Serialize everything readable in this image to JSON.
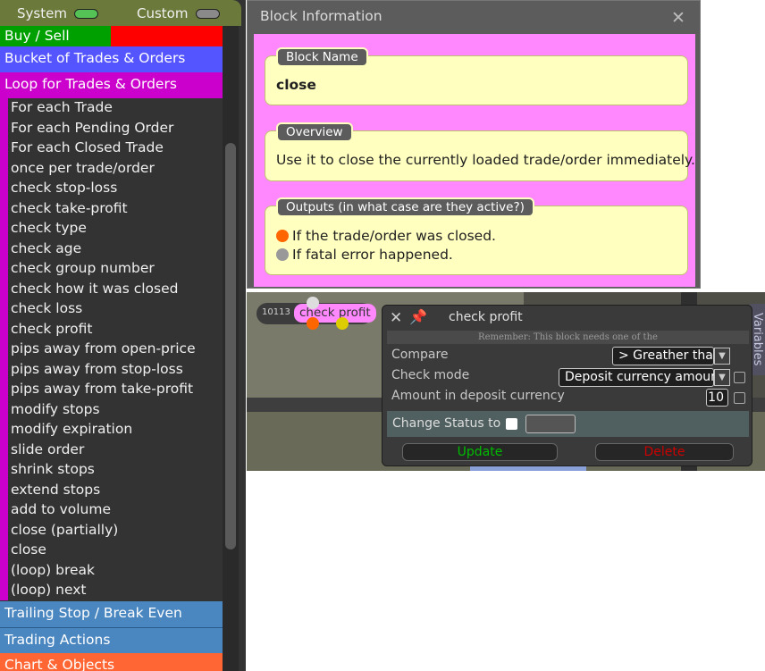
{
  "sidebar": {
    "toggles": {
      "system": "System",
      "custom": "Custom"
    },
    "categories": {
      "buy_sell": "Buy / Sell",
      "bucket": "Bucket of Trades & Orders",
      "loop": "Loop for Trades & Orders",
      "trailing": "Trailing Stop / Break Even",
      "trading_actions": "Trading Actions",
      "chart_objects": "Chart & Objects"
    },
    "items": [
      "For each Trade",
      "For each Pending Order",
      "For each Closed Trade",
      "once per trade/order",
      "check stop-loss",
      "check take-profit",
      "check type",
      "check age",
      "check group number",
      "check how it was closed",
      "check loss",
      "check profit",
      "pips away from open-price",
      "pips away from stop-loss",
      "pips away from take-profit",
      "modify stops",
      "modify expiration",
      "slide order",
      "shrink stops",
      "extend stops",
      "add to volume",
      "close (partially)",
      "close",
      "(loop) break",
      "(loop) next"
    ],
    "colors": {
      "buy": "#00a000",
      "sell": "#ff0000",
      "bucket": "#5555ff",
      "loop": "#cc00cc",
      "trailing": "#4a86c0",
      "chart": "#ff6633"
    }
  },
  "block_info": {
    "title": "Block Information",
    "block_name_label": "Block Name",
    "block_name": "close",
    "overview_label": "Overview",
    "overview": "Use it to close the currently loaded trade/order immediately.",
    "outputs_label": "Outputs (in what case are they active?)",
    "outputs": [
      {
        "color": "#ff6600",
        "text": "If the trade/order was closed."
      },
      {
        "color": "#999999",
        "text": "If fatal error happened."
      }
    ]
  },
  "canvas": {
    "node_id": "10113",
    "node_label": "check profit",
    "variables_tab": "Variables"
  },
  "dialog": {
    "title": "check profit",
    "remember": "Remember: This block needs one of the",
    "compare_label": "Compare",
    "compare_value": "> Greather than",
    "check_mode_label": "Check mode",
    "check_mode_value": "Deposit currency amount",
    "amount_label": "Amount in deposit currency",
    "amount_value": "10",
    "change_status_label": "Change Status to",
    "update_label": "Update",
    "delete_label": "Delete",
    "colors": {
      "update": "#00bb00",
      "delete": "#cc0000"
    }
  }
}
